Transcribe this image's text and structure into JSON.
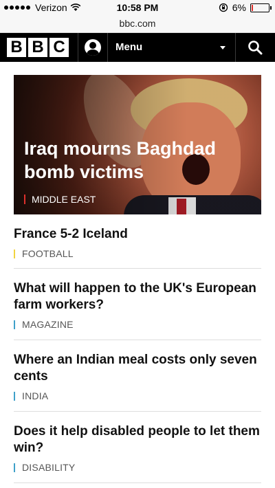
{
  "status_bar": {
    "carrier": "Verizon",
    "time": "10:58 PM",
    "battery": "6%",
    "battery_level": 0.06,
    "battery_color": "#e0302c"
  },
  "browser": {
    "url": "bbc.com"
  },
  "header": {
    "logo_letters": [
      "B",
      "B",
      "C"
    ],
    "menu_label": "Menu",
    "account_icon": "account-icon",
    "search_icon": "search-icon"
  },
  "hero": {
    "headline": "Iraq mourns Baghdad bomb victims",
    "category": "MIDDLE EAST",
    "category_color": "#e0302c"
  },
  "stories": [
    {
      "headline": "France 5-2 Iceland",
      "category": "FOOTBALL",
      "category_color": "#f1d33f"
    },
    {
      "headline": "What will happen to the UK's European farm workers?",
      "category": "MAGAZINE",
      "category_color": "#3ea0c9"
    },
    {
      "headline": "Where an Indian meal costs only seven cents",
      "category": "INDIA",
      "category_color": "#3ea0c9"
    },
    {
      "headline": "Does it help disabled people to let them win?",
      "category": "DISABILITY",
      "category_color": "#3ea0c9"
    }
  ]
}
